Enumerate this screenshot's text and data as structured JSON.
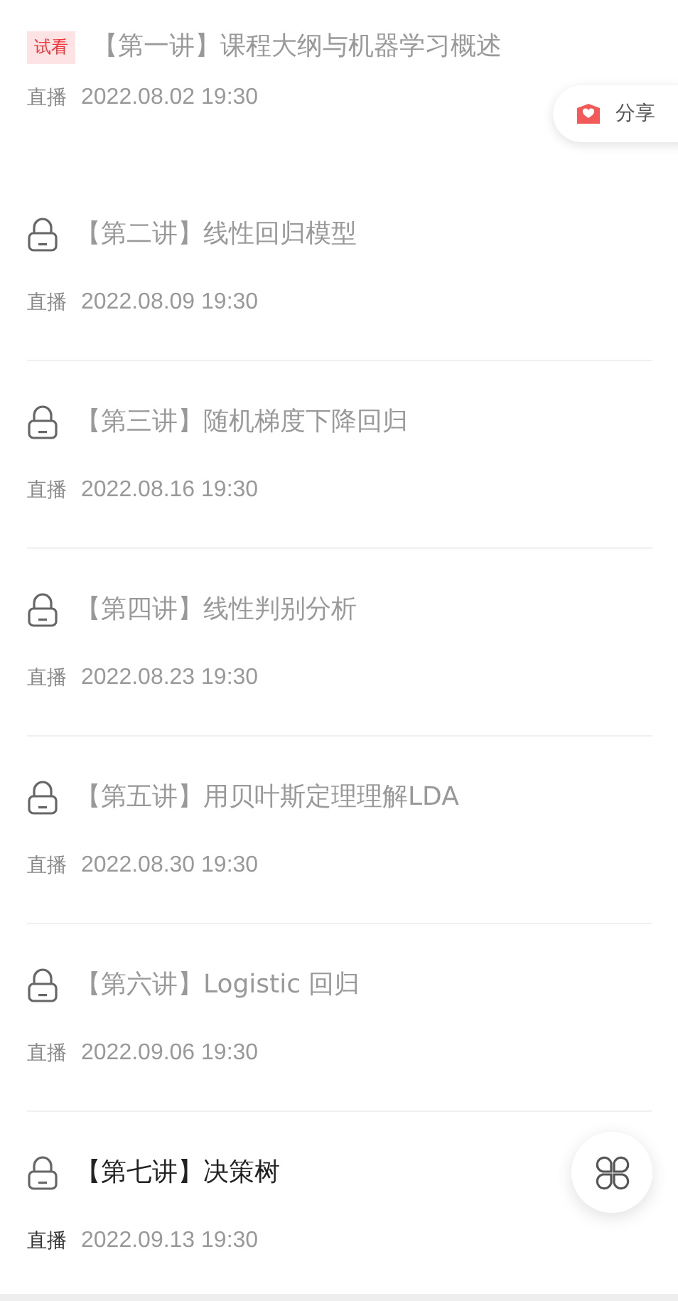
{
  "lessons": [
    {
      "kind": "trial",
      "badge": "试看",
      "title": "【第一讲】课程大纲与机器学习概述",
      "mode": "直播",
      "time": "2022.08.02 19:30",
      "selected": false
    },
    {
      "kind": "locked",
      "title": "【第二讲】线性回归模型",
      "mode": "直播",
      "time": "2022.08.09 19:30",
      "selected": false
    },
    {
      "kind": "locked",
      "title": "【第三讲】随机梯度下降回归",
      "mode": "直播",
      "time": "2022.08.16 19:30",
      "selected": false
    },
    {
      "kind": "locked",
      "title": "【第四讲】线性判别分析",
      "mode": "直播",
      "time": "2022.08.23 19:30",
      "selected": false
    },
    {
      "kind": "locked",
      "title": "【第五讲】用贝叶斯定理理解LDA",
      "mode": "直播",
      "time": "2022.08.30 19:30",
      "selected": false
    },
    {
      "kind": "locked",
      "title": "【第六讲】Logistic 回归",
      "mode": "直播",
      "time": "2022.09.06 19:30",
      "selected": false
    },
    {
      "kind": "locked",
      "title": "【第七讲】决策树",
      "mode": "直播",
      "time": "2022.09.13 19:30",
      "selected": true
    }
  ],
  "share": {
    "label": "分享"
  }
}
